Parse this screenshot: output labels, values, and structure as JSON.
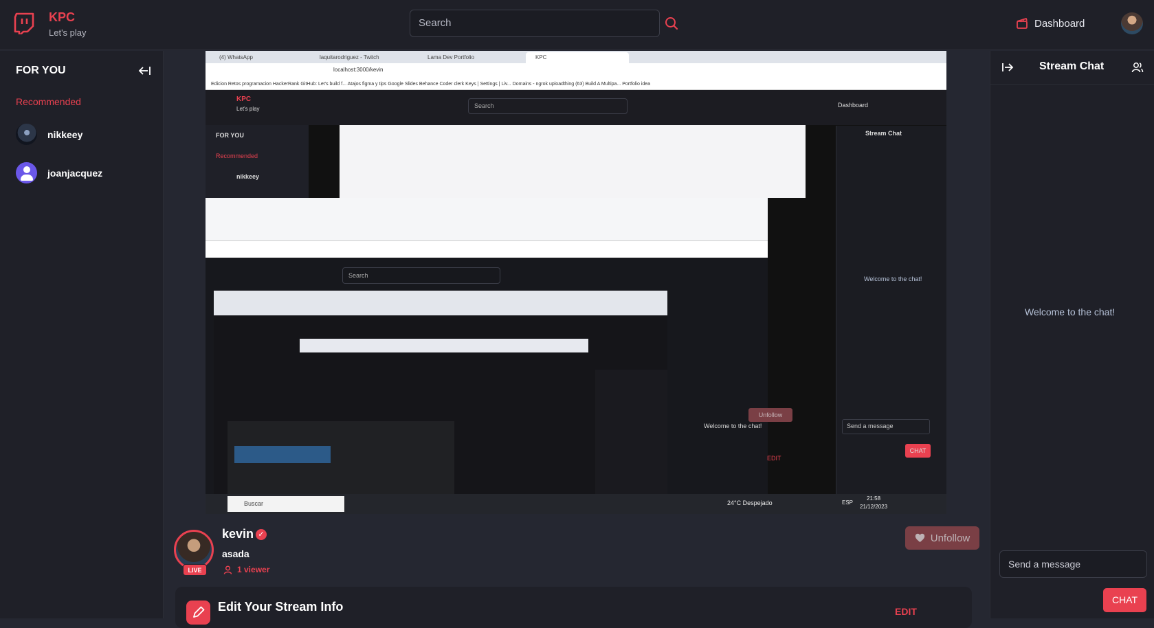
{
  "navbar": {
    "brand_title": "KPC",
    "brand_subtitle": "Let's play",
    "search_placeholder": "Search",
    "dashboard_label": "Dashboard"
  },
  "sidebar": {
    "heading": "FOR YOU",
    "recommended_label": "Recommended",
    "users": [
      {
        "name": "nikkeey"
      },
      {
        "name": "joanjacquez"
      }
    ]
  },
  "video": {
    "tabs": [
      "(4) WhatsApp",
      "laquitarodriguez - Twitch",
      "Lama Dev Portfolio",
      "KPC"
    ],
    "url": "localhost:3000/kevin",
    "bookmarks": "Edicion   Retos programacion   HackerRank   GitHub: Let's build f...   Atajos figma y tips   Google Slides   Behance   Coder   clerk   Keys | Settings | Liv...   Domains - ngrok   uploadthing   (63) Build A Multipa...   Portfolio idea",
    "inner_brand": "KPC",
    "inner_sub": "Let's play",
    "inner_search": "Search",
    "inner_dashboard": "Dashboard",
    "inner_for_you": "FOR YOU",
    "inner_recommended": "Recommended",
    "inner_user": "nikkeey",
    "inner_chat_title": "Stream Chat",
    "inner_welcome": "Welcome to the chat!",
    "inner_send": "Send a message",
    "inner_chat_btn": "CHAT",
    "inner_unfollow": "Unfollow",
    "inner_edit": "EDIT",
    "taskbar_search": "Buscar",
    "weather": "24°C  Despejado",
    "lang": "ESP",
    "time": "21:58",
    "date": "21/12/2023"
  },
  "stream": {
    "streamer": "kevin",
    "title": "asada",
    "viewers": "1 viewer",
    "live": "LIVE",
    "unfollow_label": "Unfollow",
    "edit_title": "Edit Your Stream Info",
    "edit_label": "EDIT"
  },
  "chat": {
    "title": "Stream Chat",
    "welcome": "Welcome to the chat!",
    "input_placeholder": "Send a message",
    "send_label": "CHAT"
  },
  "colors": {
    "accent": "#e94150",
    "background": "#252731",
    "panel": "#1f2028"
  }
}
